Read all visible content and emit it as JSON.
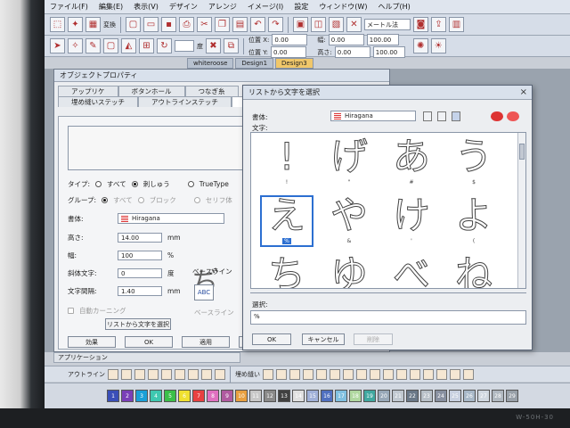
{
  "menubar": [
    "ファイル(F)",
    "編集(E)",
    "表示(V)",
    "デザイン",
    "アレンジ",
    "イメージ(I)",
    "設定",
    "ウィンドウ(W)",
    "ヘルプ(H)"
  ],
  "toolbar": {
    "compose_label": "変換",
    "unit_select": "メートル法",
    "pos_x_label": "位置 X:",
    "pos_y_label": "位置 Y:",
    "width_label": "幅:",
    "height_label": "高さ:",
    "pos_x": "0.00",
    "pos_y": "0.00",
    "width": "0.00",
    "height": "0.00",
    "scale_w": "100.00",
    "scale_h": "100.00",
    "degree_label": "度"
  },
  "doc_tabs": [
    "whiteroose",
    "Design1",
    "Design3"
  ],
  "object_properties": {
    "title": "オブジェクトプロパティ",
    "tabs_row1": [
      "アップリケ",
      "ボタンホール",
      "つなぎ糸"
    ],
    "tabs_row2": [
      "埋め縫いステッチ",
      "アウトラインステッチ",
      "レタリング"
    ],
    "type_label": "タイプ:",
    "type_options": [
      "すべて",
      "刺しゅう",
      "TrueType"
    ],
    "group_label": "グループ:",
    "group_options": [
      "すべて",
      "ブロック",
      "セリフ体"
    ],
    "font_label": "書体:",
    "font_value": "Hiragana",
    "height_label": "高さ:",
    "height_value": "14.00",
    "height_unit": "mm",
    "width_label": "幅:",
    "width_value": "100",
    "width_unit": "%",
    "slant_label": "斜体文字:",
    "slant_value": "0",
    "slant_unit": "度",
    "spacing_label": "文字間隔:",
    "spacing_value": "1.40",
    "spacing_unit": "mm",
    "baseline_label": "ベースライン",
    "baseline_label2": "ベースライン",
    "auto_kerning": "自動カーニング",
    "choose_from_list": "リストから文字を選択",
    "preview_glyph": "ぢ",
    "abc": "ABC",
    "buttons": [
      "効果",
      "OK",
      "適用",
      "閉"
    ]
  },
  "glyph_dialog": {
    "title": "リストから文字を選択",
    "font_label": "書体:",
    "font_value": "Hiragana",
    "chars_label": "文字:",
    "cells": [
      {
        "glyph": "!",
        "code": "!"
      },
      {
        "glyph": "げ",
        "code": "\""
      },
      {
        "glyph": "あ",
        "code": "#"
      },
      {
        "glyph": "う",
        "code": "$"
      },
      {
        "glyph": "え",
        "code": "%"
      },
      {
        "glyph": "や",
        "code": "&"
      },
      {
        "glyph": "け",
        "code": "'"
      },
      {
        "glyph": "よ",
        "code": "("
      },
      {
        "glyph": "ち",
        "code": ""
      },
      {
        "glyph": "ゆ",
        "code": ""
      },
      {
        "glyph": "べ",
        "code": ""
      },
      {
        "glyph": "ね",
        "code": ""
      }
    ],
    "selected_index": 4,
    "selection_label": "選択:",
    "selection_value": "%",
    "ok": "OK",
    "cancel": "キャンセル",
    "clear": "削除"
  },
  "application_panel": "アプリケーション",
  "stitch_bar": {
    "outline_label": "アウトライン",
    "fill_label": "埋め縫い"
  },
  "color_palette": {
    "numbers": [
      "1",
      "2",
      "3",
      "4",
      "5",
      "6",
      "7",
      "8",
      "9",
      "10",
      "11",
      "12",
      "13",
      "14",
      "15",
      "16",
      "17",
      "18",
      "19",
      "20",
      "21",
      "22",
      "23",
      "24",
      "25",
      "26",
      "27",
      "28",
      "29"
    ],
    "colors": [
      "#3a4fb8",
      "#7a3fb8",
      "#1aa0d8",
      "#3ec8b0",
      "#3bbf4a",
      "#f0e030",
      "#e84040",
      "#e070c0",
      "#b05aa0",
      "#e8a040",
      "#c8c8c8",
      "#8a8a8a",
      "#404040",
      "#e0e0e0",
      "#a0b0d8",
      "#5070c0",
      "#80c0e0",
      "#b0d8a0",
      "#40a8a0",
      "#98a8b8",
      "#c0c8d0",
      "#6a7888",
      "#b8c0c8",
      "#8890a0",
      "#c8d0e0",
      "#a8b8c8",
      "#d0d8e0",
      "#b0b8c0",
      "#98a0a8"
    ]
  },
  "monitor_label": "W-50H-30"
}
